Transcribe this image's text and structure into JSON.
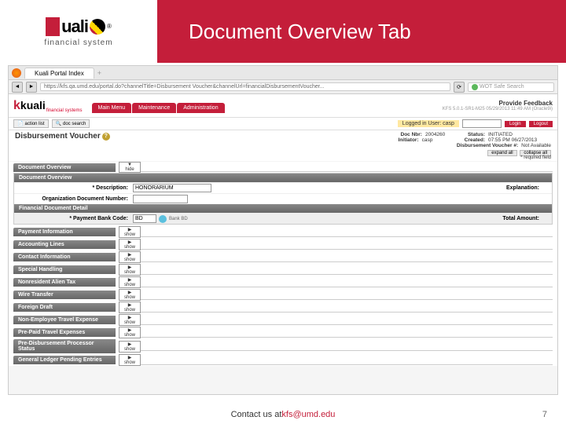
{
  "slide": {
    "title": "Document Overview Tab"
  },
  "logo": {
    "main": "uali",
    "sub": "financial system",
    "reg": "®"
  },
  "browser": {
    "tab": "Kuali Portal Index",
    "url": "https://kfs.qa.umd.edu/portal.do?channelTitle=Disbursement Voucher&channelUrl=financialDisbursementVoucher...",
    "search": "WOT Safe Search"
  },
  "app": {
    "logo_main": "kuali",
    "logo_sub": "financial systems",
    "tabs": {
      "main": "Main Menu",
      "maint": "Maintenance",
      "admin": "Administration"
    },
    "feedback": "Provide Feedback",
    "version": "KFS 5.0.1-SR1-M25 05/29/2013 11:49 AM (Oracle9i)"
  },
  "util": {
    "action_list": "action list",
    "doc_search": "doc search",
    "logged_in": "Logged in User: casp",
    "login": "Login",
    "logout": "Logout"
  },
  "doc": {
    "title": "Disbursement Voucher",
    "meta": {
      "doc_nbr_label": "Doc Nbr:",
      "doc_nbr": "2004260",
      "status_label": "Status:",
      "status": "INITIATED",
      "initiator_label": "Initiator:",
      "initiator": "casp",
      "created_label": "Created:",
      "created": "07:55 PM 06/27/2013",
      "dv_label": "Disbursement Voucher #:",
      "dv": "Not Available"
    },
    "expand": "expand all",
    "collapse": "collapse all",
    "required": "* required field"
  },
  "overview": {
    "tab": "Document Overview",
    "hide": "▼ hide",
    "section": "Document Overview",
    "desc_label": "* Description:",
    "desc_value": "HONORARIUM",
    "explanation": "Explanation:",
    "org_label": "Organization Document Number:",
    "detail_section": "Financial Document Detail",
    "bank_label": "* Payment Bank Code:",
    "bank_value": "BD",
    "bank_name": "Bank BD",
    "total_label": "Total Amount:"
  },
  "tabs": {
    "show": "▶ show",
    "t1": "Payment Information",
    "t2": "Accounting Lines",
    "t3": "Contact Information",
    "t4": "Special Handling",
    "t5": "Nonresident Alien Tax",
    "t6": "Wire Transfer",
    "t7": "Foreign Draft",
    "t8": "Non-Employee Travel Expense",
    "t9": "Pre-Paid Travel Expenses",
    "t10": "Pre-Disbursement Processor Status",
    "t11": "General Ledger Pending Entries"
  },
  "footer": {
    "label": "Contact us at ",
    "email": "kfs@umd.edu",
    "page": "7"
  }
}
